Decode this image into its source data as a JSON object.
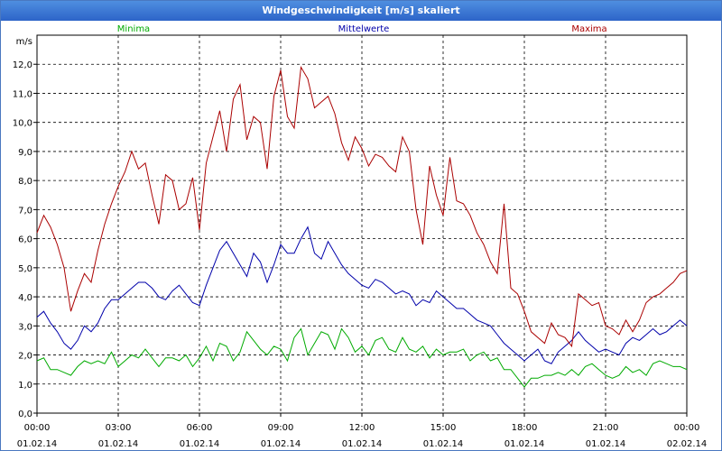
{
  "window": {
    "title": "Windgeschwindigkeit [m/s] skaliert"
  },
  "chart_data": {
    "type": "line",
    "title": "Windgeschwindigkeit [m/s] skaliert",
    "ylabel": "m/s",
    "ylim": [
      0,
      13
    ],
    "xlim_hours": [
      0,
      24
    ],
    "grid": true,
    "legend_placement": "top",
    "y_ticks": [
      "0,0",
      "1,0",
      "2,0",
      "3,0",
      "4,0",
      "5,0",
      "6,0",
      "7,0",
      "8,0",
      "9,0",
      "10,0",
      "11,0",
      "12,0"
    ],
    "x_ticks": [
      {
        "time": "00:00",
        "date": "01.02.14"
      },
      {
        "time": "03:00",
        "date": "01.02.14"
      },
      {
        "time": "06:00",
        "date": "01.02.14"
      },
      {
        "time": "09:00",
        "date": "01.02.14"
      },
      {
        "time": "12:00",
        "date": "01.02.14"
      },
      {
        "time": "15:00",
        "date": "01.02.14"
      },
      {
        "time": "18:00",
        "date": "01.02.14"
      },
      {
        "time": "21:00",
        "date": "01.02.14"
      },
      {
        "time": "00:00",
        "date": "02.02.14"
      }
    ],
    "x_hours": [
      0,
      0.25,
      0.5,
      0.75,
      1,
      1.25,
      1.5,
      1.75,
      2,
      2.25,
      2.5,
      2.75,
      3,
      3.25,
      3.5,
      3.75,
      4,
      4.25,
      4.5,
      4.75,
      5,
      5.25,
      5.5,
      5.75,
      6,
      6.25,
      6.5,
      6.75,
      7,
      7.25,
      7.5,
      7.75,
      8,
      8.25,
      8.5,
      8.75,
      9,
      9.25,
      9.5,
      9.75,
      10,
      10.25,
      10.5,
      10.75,
      11,
      11.25,
      11.5,
      11.75,
      12,
      12.25,
      12.5,
      12.75,
      13,
      13.25,
      13.5,
      13.75,
      14,
      14.25,
      14.5,
      14.75,
      15,
      15.25,
      15.5,
      15.75,
      16,
      16.25,
      16.5,
      16.75,
      17,
      17.25,
      17.5,
      17.75,
      18,
      18.25,
      18.5,
      18.75,
      19,
      19.25,
      19.5,
      19.75,
      20,
      20.25,
      20.5,
      20.75,
      21,
      21.25,
      21.5,
      21.75,
      22,
      22.25,
      22.5,
      22.75,
      23,
      23.25,
      23.5,
      23.75,
      24
    ],
    "series": [
      {
        "name": "Minima",
        "color": "#00aa00",
        "values": [
          1.8,
          1.9,
          1.5,
          1.5,
          1.4,
          1.3,
          1.6,
          1.8,
          1.7,
          1.8,
          1.7,
          2.1,
          1.6,
          1.8,
          2.0,
          1.9,
          2.2,
          1.9,
          1.6,
          1.9,
          1.9,
          1.8,
          2.0,
          1.6,
          1.9,
          2.3,
          1.8,
          2.4,
          2.3,
          1.8,
          2.1,
          2.8,
          2.5,
          2.2,
          2.0,
          2.3,
          2.2,
          1.8,
          2.6,
          2.9,
          2.0,
          2.4,
          2.8,
          2.7,
          2.2,
          2.9,
          2.6,
          2.1,
          2.3,
          2.0,
          2.5,
          2.6,
          2.2,
          2.1,
          2.6,
          2.2,
          2.1,
          2.3,
          1.9,
          2.2,
          2.0,
          2.1,
          2.1,
          2.2,
          1.8,
          2.0,
          2.1,
          1.8,
          1.9,
          1.5,
          1.5,
          1.2,
          0.9,
          1.2,
          1.2,
          1.3,
          1.3,
          1.4,
          1.3,
          1.5,
          1.3,
          1.6,
          1.7,
          1.5,
          1.3,
          1.2,
          1.3,
          1.6,
          1.4,
          1.5,
          1.3,
          1.7,
          1.8,
          1.7,
          1.6,
          1.6,
          1.5,
          1.4,
          1.4
        ]
      },
      {
        "name": "Mittelwerte",
        "color": "#0000aa",
        "values": [
          3.3,
          3.5,
          3.1,
          2.8,
          2.4,
          2.2,
          2.5,
          3.0,
          2.8,
          3.1,
          3.6,
          3.9,
          3.9,
          4.1,
          4.3,
          4.5,
          4.5,
          4.3,
          4.0,
          3.9,
          4.2,
          4.4,
          4.1,
          3.8,
          3.7,
          4.4,
          5.0,
          5.6,
          5.9,
          5.5,
          5.1,
          4.7,
          5.5,
          5.2,
          4.5,
          5.1,
          5.8,
          5.5,
          5.5,
          6.0,
          6.4,
          5.5,
          5.3,
          5.9,
          5.5,
          5.1,
          4.8,
          4.6,
          4.4,
          4.3,
          4.6,
          4.5,
          4.3,
          4.1,
          4.2,
          4.1,
          3.7,
          3.9,
          3.8,
          4.2,
          4.0,
          3.8,
          3.6,
          3.6,
          3.4,
          3.2,
          3.1,
          3.0,
          2.7,
          2.4,
          2.2,
          2.0,
          1.8,
          2.0,
          2.2,
          1.8,
          1.7,
          2.1,
          2.3,
          2.5,
          2.8,
          2.5,
          2.3,
          2.1,
          2.2,
          2.1,
          2.0,
          2.4,
          2.6,
          2.5,
          2.7,
          2.9,
          2.7,
          2.8,
          3.0,
          3.2,
          3.0,
          3.0,
          2.6
        ]
      },
      {
        "name": "Maxima",
        "color": "#aa0000",
        "values": [
          6.2,
          6.8,
          6.4,
          5.8,
          5.0,
          3.5,
          4.2,
          4.8,
          4.5,
          5.6,
          6.5,
          7.2,
          7.8,
          8.3,
          9.0,
          8.4,
          8.6,
          7.5,
          6.5,
          8.2,
          8.0,
          7.0,
          7.2,
          8.1,
          6.3,
          8.6,
          9.5,
          10.4,
          9.0,
          10.8,
          11.3,
          9.4,
          10.2,
          10.0,
          8.4,
          10.9,
          11.8,
          10.2,
          9.8,
          11.9,
          11.5,
          10.5,
          10.7,
          10.9,
          10.3,
          9.3,
          8.7,
          9.5,
          9.1,
          8.5,
          8.9,
          8.8,
          8.5,
          8.3,
          9.5,
          9.0,
          7.0,
          5.8,
          8.5,
          7.5,
          6.8,
          8.8,
          7.3,
          7.2,
          6.8,
          6.2,
          5.8,
          5.2,
          4.8,
          7.2,
          4.3,
          4.1,
          3.5,
          2.8,
          2.6,
          2.4,
          3.1,
          2.7,
          2.6,
          2.3,
          4.1,
          3.9,
          3.7,
          3.8,
          3.0,
          2.9,
          2.7,
          3.2,
          2.8,
          3.2,
          3.8,
          4.0,
          4.1,
          4.3,
          4.5,
          4.8,
          4.9,
          4.7,
          4.4
        ]
      }
    ]
  }
}
